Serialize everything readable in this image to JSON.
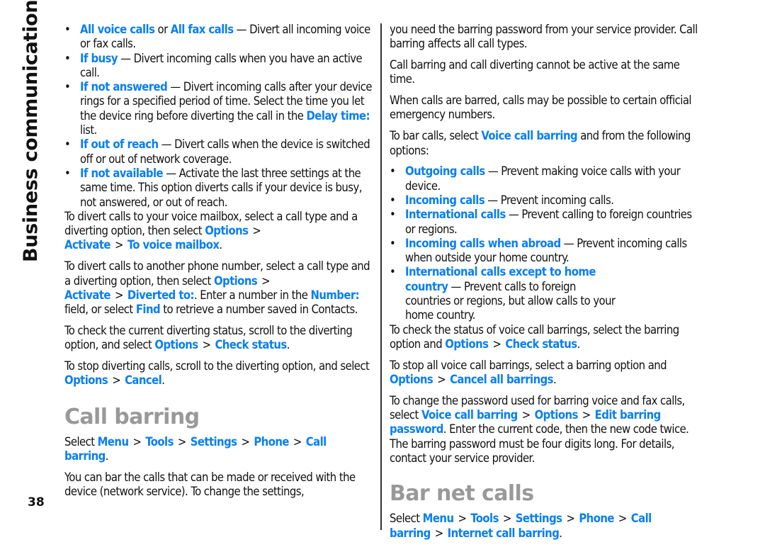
{
  "side_label": "Business communications",
  "page_number": "38",
  "left_column": {
    "divert_options": [
      {
        "links": [
          "All voice calls",
          "All fax calls"
        ],
        "joiner": " or ",
        "text": " — Divert all incoming voice or fax calls."
      },
      {
        "link": "If busy",
        "text": " — Divert incoming calls when you have an active call."
      },
      {
        "link": "If not answered",
        "text": " — Divert incoming calls after your device rings for a specified period of time. Select the time you let the device ring before diverting the call in the ",
        "link2": "Delay time:",
        "text2": " list."
      },
      {
        "link": "If out of reach",
        "text": " — Divert calls when the device is switched off or out of network coverage."
      },
      {
        "link": "If not available",
        "text": " — Activate the last three settings at the same time. This option diverts calls if your device is busy, not answered, or out of reach."
      }
    ],
    "voicemail_para": {
      "text": "To divert calls to your voice mailbox, select a call type and a diverting option, then select ",
      "path": [
        "Options",
        "Activate",
        "To voice mailbox"
      ],
      "end": "."
    },
    "number_para": {
      "text": "To divert calls to another phone number, select a call type and a diverting option, then select ",
      "path": [
        "Options",
        "Activate",
        "Diverted to:"
      ],
      "mid": ". Enter a number in the ",
      "field_link": "Number:",
      "mid2": " field, or select ",
      "find_link": "Find",
      "end": " to retrieve a number saved in Contacts."
    },
    "check_para": {
      "text": "To check the current diverting status, scroll to the diverting option, and select ",
      "path": [
        "Options",
        "Check status"
      ],
      "end": "."
    },
    "stop_para": {
      "text": "To stop diverting calls, scroll to the diverting option, and select ",
      "path": [
        "Options",
        "Cancel"
      ],
      "end": "."
    },
    "call_barring": {
      "heading": "Call barring",
      "select_word": "Select ",
      "path": [
        "Menu",
        "Tools",
        "Settings",
        "Phone",
        "Call barring"
      ],
      "end": ".",
      "intro": "You can bar the calls that can be made or received with the device (network service). To change the settings,"
    }
  },
  "right_column": {
    "continued": "you need the barring password from your service provider. Call barring affects all call types.",
    "para_active": "Call barring and call diverting cannot be active at the same time.",
    "para_emergency": "When calls are barred, calls may be possible to certain official emergency numbers.",
    "bar_para": {
      "text": "To bar calls, select ",
      "link": "Voice call barring",
      "end": " and from the following options:"
    },
    "barring_options": [
      {
        "link": "Outgoing calls",
        "text": " — Prevent making voice calls with your device."
      },
      {
        "link": "Incoming calls",
        "text": " — Prevent incoming calls."
      },
      {
        "link": "International calls",
        "text": " — Prevent calling to foreign countries or regions."
      },
      {
        "link": "Incoming calls when abroad",
        "text": " — Prevent incoming calls when outside your home country."
      },
      {
        "link": "International calls except to home country",
        "text": " — Prevent calls to foreign countries or regions, but allow calls to your home country."
      }
    ],
    "status_para": {
      "text": "To check the status of voice call barrings, select the barring option and ",
      "path": [
        "Options",
        "Check status"
      ],
      "end": "."
    },
    "stop_para": {
      "text": "To stop all voice call barrings, select a barring option and ",
      "path": [
        "Options",
        "Cancel all barrings"
      ],
      "end": "."
    },
    "password_para": {
      "text": "To change the password used for barring voice and fax calls, select ",
      "path": [
        "Voice call barring",
        "Options",
        "Edit barring password"
      ],
      "end": ". Enter the current code, then the new code twice. The barring password must be four digits long. For details, contact your service provider."
    },
    "bar_net_calls": {
      "heading": "Bar net calls",
      "select_word": "Select ",
      "path": [
        "Menu",
        "Tools",
        "Settings",
        "Phone",
        "Call barring",
        "Internet call barring"
      ],
      "end": "."
    }
  },
  "colors": {
    "link": "#0a7ff0",
    "heading": "#999999",
    "body_text": "#111111"
  }
}
